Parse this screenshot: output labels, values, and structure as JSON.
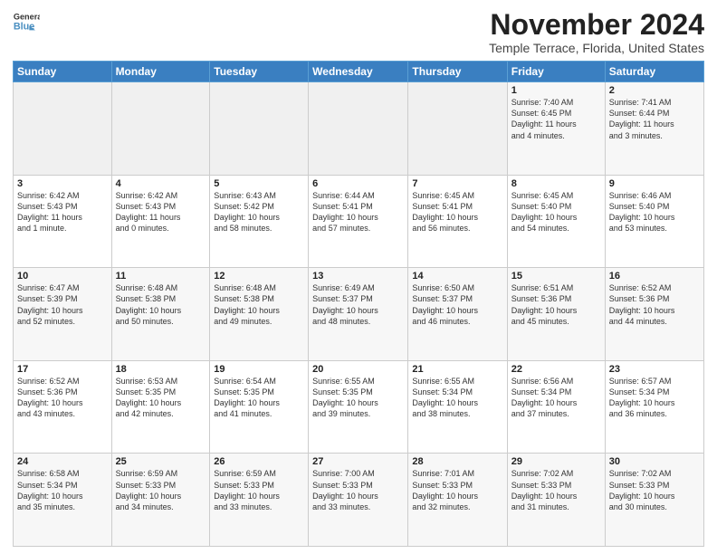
{
  "header": {
    "logo_line1": "General",
    "logo_line2": "Blue",
    "title": "November 2024",
    "subtitle": "Temple Terrace, Florida, United States"
  },
  "calendar": {
    "days_of_week": [
      "Sunday",
      "Monday",
      "Tuesday",
      "Wednesday",
      "Thursday",
      "Friday",
      "Saturday"
    ],
    "weeks": [
      [
        {
          "day": "",
          "info": ""
        },
        {
          "day": "",
          "info": ""
        },
        {
          "day": "",
          "info": ""
        },
        {
          "day": "",
          "info": ""
        },
        {
          "day": "",
          "info": ""
        },
        {
          "day": "1",
          "info": "Sunrise: 7:40 AM\nSunset: 6:45 PM\nDaylight: 11 hours\nand 4 minutes."
        },
        {
          "day": "2",
          "info": "Sunrise: 7:41 AM\nSunset: 6:44 PM\nDaylight: 11 hours\nand 3 minutes."
        }
      ],
      [
        {
          "day": "3",
          "info": "Sunrise: 6:42 AM\nSunset: 5:43 PM\nDaylight: 11 hours\nand 1 minute."
        },
        {
          "day": "4",
          "info": "Sunrise: 6:42 AM\nSunset: 5:43 PM\nDaylight: 11 hours\nand 0 minutes."
        },
        {
          "day": "5",
          "info": "Sunrise: 6:43 AM\nSunset: 5:42 PM\nDaylight: 10 hours\nand 58 minutes."
        },
        {
          "day": "6",
          "info": "Sunrise: 6:44 AM\nSunset: 5:41 PM\nDaylight: 10 hours\nand 57 minutes."
        },
        {
          "day": "7",
          "info": "Sunrise: 6:45 AM\nSunset: 5:41 PM\nDaylight: 10 hours\nand 56 minutes."
        },
        {
          "day": "8",
          "info": "Sunrise: 6:45 AM\nSunset: 5:40 PM\nDaylight: 10 hours\nand 54 minutes."
        },
        {
          "day": "9",
          "info": "Sunrise: 6:46 AM\nSunset: 5:40 PM\nDaylight: 10 hours\nand 53 minutes."
        }
      ],
      [
        {
          "day": "10",
          "info": "Sunrise: 6:47 AM\nSunset: 5:39 PM\nDaylight: 10 hours\nand 52 minutes."
        },
        {
          "day": "11",
          "info": "Sunrise: 6:48 AM\nSunset: 5:38 PM\nDaylight: 10 hours\nand 50 minutes."
        },
        {
          "day": "12",
          "info": "Sunrise: 6:48 AM\nSunset: 5:38 PM\nDaylight: 10 hours\nand 49 minutes."
        },
        {
          "day": "13",
          "info": "Sunrise: 6:49 AM\nSunset: 5:37 PM\nDaylight: 10 hours\nand 48 minutes."
        },
        {
          "day": "14",
          "info": "Sunrise: 6:50 AM\nSunset: 5:37 PM\nDaylight: 10 hours\nand 46 minutes."
        },
        {
          "day": "15",
          "info": "Sunrise: 6:51 AM\nSunset: 5:36 PM\nDaylight: 10 hours\nand 45 minutes."
        },
        {
          "day": "16",
          "info": "Sunrise: 6:52 AM\nSunset: 5:36 PM\nDaylight: 10 hours\nand 44 minutes."
        }
      ],
      [
        {
          "day": "17",
          "info": "Sunrise: 6:52 AM\nSunset: 5:36 PM\nDaylight: 10 hours\nand 43 minutes."
        },
        {
          "day": "18",
          "info": "Sunrise: 6:53 AM\nSunset: 5:35 PM\nDaylight: 10 hours\nand 42 minutes."
        },
        {
          "day": "19",
          "info": "Sunrise: 6:54 AM\nSunset: 5:35 PM\nDaylight: 10 hours\nand 41 minutes."
        },
        {
          "day": "20",
          "info": "Sunrise: 6:55 AM\nSunset: 5:35 PM\nDaylight: 10 hours\nand 39 minutes."
        },
        {
          "day": "21",
          "info": "Sunrise: 6:55 AM\nSunset: 5:34 PM\nDaylight: 10 hours\nand 38 minutes."
        },
        {
          "day": "22",
          "info": "Sunrise: 6:56 AM\nSunset: 5:34 PM\nDaylight: 10 hours\nand 37 minutes."
        },
        {
          "day": "23",
          "info": "Sunrise: 6:57 AM\nSunset: 5:34 PM\nDaylight: 10 hours\nand 36 minutes."
        }
      ],
      [
        {
          "day": "24",
          "info": "Sunrise: 6:58 AM\nSunset: 5:34 PM\nDaylight: 10 hours\nand 35 minutes."
        },
        {
          "day": "25",
          "info": "Sunrise: 6:59 AM\nSunset: 5:33 PM\nDaylight: 10 hours\nand 34 minutes."
        },
        {
          "day": "26",
          "info": "Sunrise: 6:59 AM\nSunset: 5:33 PM\nDaylight: 10 hours\nand 33 minutes."
        },
        {
          "day": "27",
          "info": "Sunrise: 7:00 AM\nSunset: 5:33 PM\nDaylight: 10 hours\nand 33 minutes."
        },
        {
          "day": "28",
          "info": "Sunrise: 7:01 AM\nSunset: 5:33 PM\nDaylight: 10 hours\nand 32 minutes."
        },
        {
          "day": "29",
          "info": "Sunrise: 7:02 AM\nSunset: 5:33 PM\nDaylight: 10 hours\nand 31 minutes."
        },
        {
          "day": "30",
          "info": "Sunrise: 7:02 AM\nSunset: 5:33 PM\nDaylight: 10 hours\nand 30 minutes."
        }
      ]
    ]
  }
}
